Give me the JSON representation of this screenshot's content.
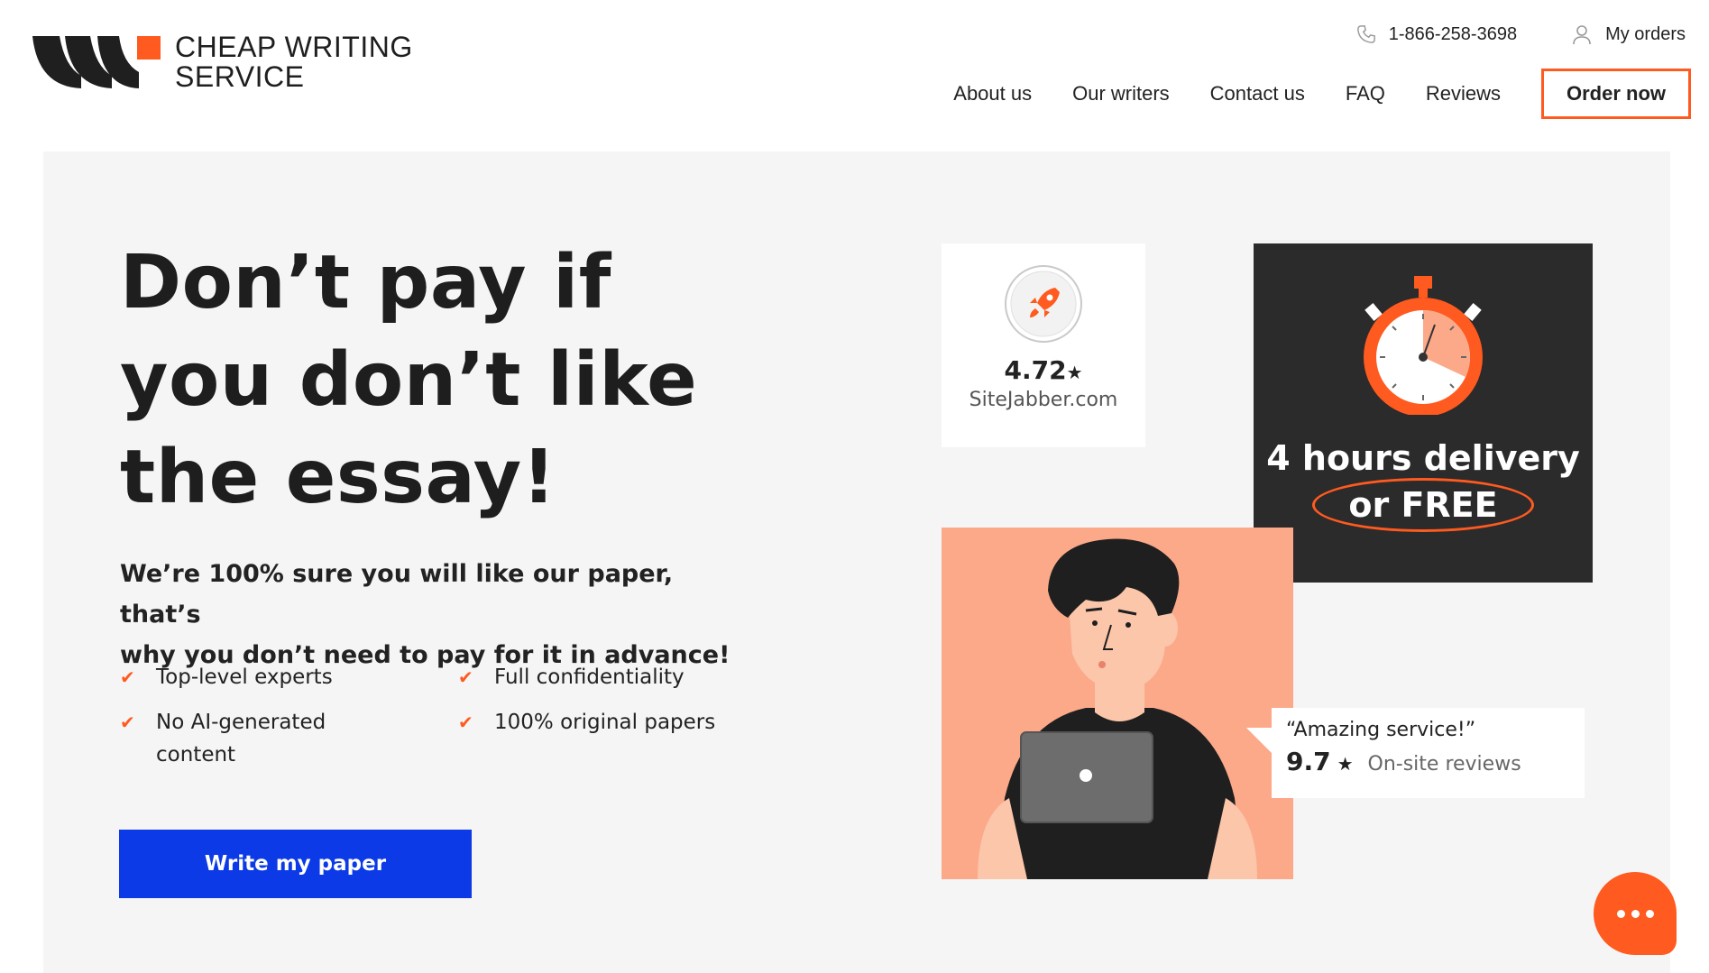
{
  "header": {
    "brand_line1": "CHEAP WRITING",
    "brand_line2": "SERVICE",
    "phone": "1-866-258-3698",
    "my_orders": "My orders",
    "nav": [
      "About us",
      "Our writers",
      "Contact us",
      "FAQ",
      "Reviews"
    ],
    "order_now": "Order now"
  },
  "hero": {
    "headline_lines": [
      "Don’t pay if",
      "you don’t like",
      "the essay!"
    ],
    "sub_lines": [
      "We’re 100% sure you will like our paper, that’s",
      "why you don’t need to pay for it in advance!"
    ],
    "features": [
      "Top-level experts",
      "Full confidentiality",
      "No AI-generated content",
      "100% original papers"
    ],
    "cta": "Write my paper"
  },
  "sitejabber": {
    "rating": "4.72",
    "site": "SiteJabber.com"
  },
  "delivery": {
    "line1": "4 hours delivery",
    "line2": "or FREE"
  },
  "review": {
    "quote": "“Amazing service!”",
    "score": "9.7",
    "label": "On-site reviews"
  },
  "icons": {
    "phone": "phone-icon",
    "user": "user-icon",
    "check": "check-icon",
    "rocket": "rocket-icon",
    "stopwatch": "stopwatch-icon",
    "chat": "chat-icon"
  },
  "colors": {
    "accent": "#ff5a1f",
    "cta_blue": "#0b3ae6",
    "dark_card": "#2b2b2b",
    "person_bg": "#fca98a"
  }
}
